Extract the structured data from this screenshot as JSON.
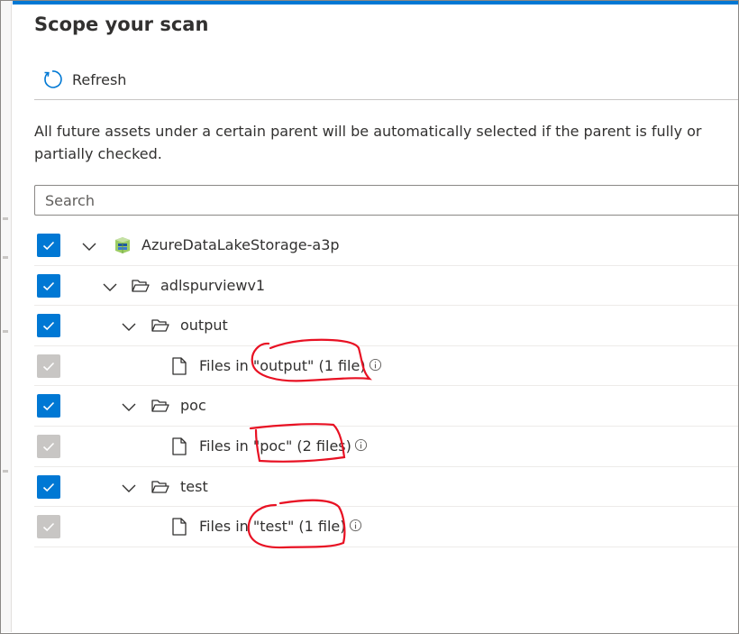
{
  "panel": {
    "title": "Scope your scan",
    "toolbar": {
      "refresh_label": "Refresh",
      "refresh_icon": "refresh-icon"
    },
    "description": "All future assets under a certain parent will be automatically selected if the parent is fully or partially checked.",
    "search": {
      "placeholder": "Search",
      "value": ""
    }
  },
  "tree": {
    "rows": [
      {
        "label": "AzureDataLakeStorage-a3p",
        "checked": true,
        "disabled": false,
        "icon": "storage-account-icon",
        "expanded": true
      },
      {
        "label": "adlspurviewv1",
        "checked": true,
        "disabled": false,
        "icon": "folder-open-icon",
        "expanded": true
      },
      {
        "label": "output",
        "checked": true,
        "disabled": false,
        "icon": "folder-open-icon",
        "expanded": true
      },
      {
        "label": "Files in \"output\" (1 file)",
        "checked": true,
        "disabled": true,
        "icon": "file-icon"
      },
      {
        "label": "poc",
        "checked": true,
        "disabled": false,
        "icon": "folder-open-icon",
        "expanded": true
      },
      {
        "label": "Files in \"poc\" (2 files)",
        "checked": true,
        "disabled": true,
        "icon": "file-icon"
      },
      {
        "label": "test",
        "checked": true,
        "disabled": false,
        "icon": "folder-open-icon",
        "expanded": true
      },
      {
        "label": "Files in \"test\" (1 file)",
        "checked": true,
        "disabled": true,
        "icon": "file-icon"
      }
    ]
  },
  "colors": {
    "accent": "#0078d4",
    "checkbox_disabled": "#c8c6c4",
    "annotation_red": "#e81123"
  }
}
